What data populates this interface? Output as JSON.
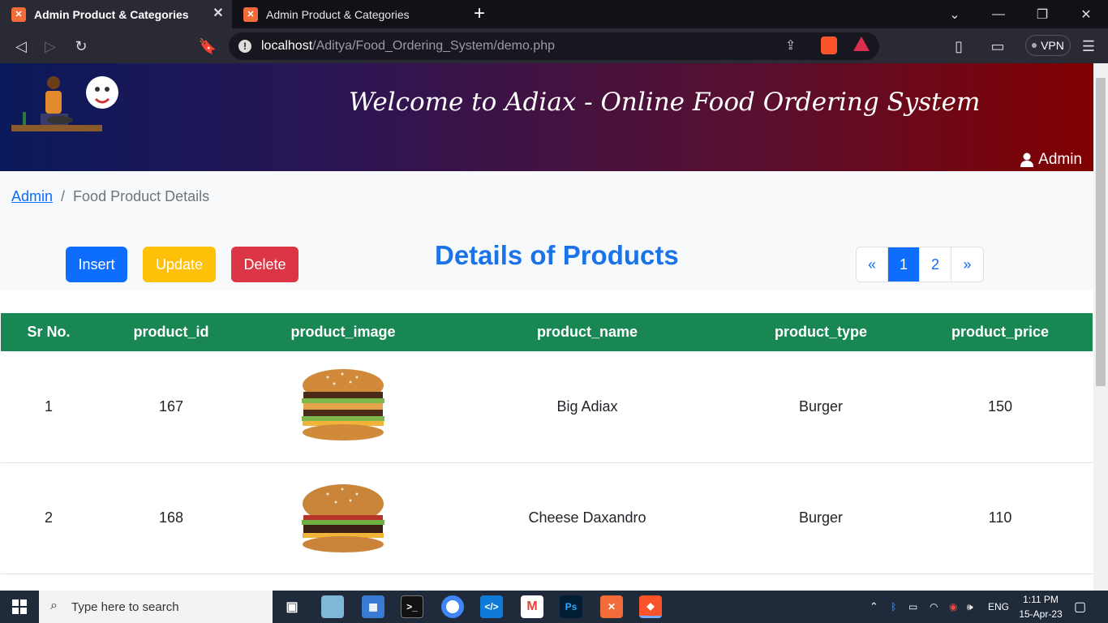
{
  "browser": {
    "tabs": [
      {
        "title": "Admin Product & Categories",
        "active": true
      },
      {
        "title": "Admin Product & Categories",
        "active": false
      }
    ],
    "url_host": "localhost",
    "url_path": "/Aditya/Food_Ordering_System/demo.php",
    "vpn_label": "VPN"
  },
  "header": {
    "title": "Welcome to Adiax - Online Food Ordering System",
    "user_label": "Admin"
  },
  "breadcrumb": {
    "root": "Admin",
    "separator": "/",
    "current": "Food Product Details"
  },
  "actions": {
    "insert": "Insert",
    "update": "Update",
    "delete": "Delete"
  },
  "section_title": "Details of Products",
  "pagination": {
    "prev": "«",
    "pages": [
      "1",
      "2"
    ],
    "active_page": "1",
    "next": "»"
  },
  "table": {
    "headers": [
      "Sr No.",
      "product_id",
      "product_image",
      "product_name",
      "product_type",
      "product_price"
    ],
    "rows": [
      {
        "sr": "1",
        "id": "167",
        "image": "burger-big",
        "name": "Big Adiax",
        "type": "Burger",
        "price": "150"
      },
      {
        "sr": "2",
        "id": "168",
        "image": "burger-cheese",
        "name": "Cheese Daxandro",
        "type": "Burger",
        "price": "110"
      }
    ]
  },
  "taskbar": {
    "search_placeholder": "Type here to search",
    "language": "ENG",
    "time": "1:11 PM",
    "date": "15-Apr-23"
  },
  "colors": {
    "primary": "#0d6efd",
    "warning": "#ffc107",
    "danger": "#dc3545",
    "table_header": "#198754",
    "title": "#1a73e8"
  }
}
